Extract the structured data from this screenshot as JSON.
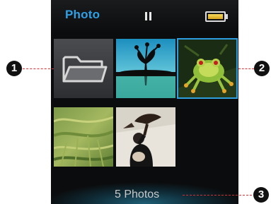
{
  "header": {
    "title": "Photo",
    "playback_icon": "pause-icon",
    "battery_icon": "battery-icon",
    "title_color": "#2f9fe6"
  },
  "grid": {
    "items": [
      {
        "kind": "folder",
        "icon": "folder-icon"
      },
      {
        "kind": "photo",
        "subject": "tree-silhouette-photo"
      },
      {
        "kind": "photo",
        "subject": "frog-photo",
        "selected": true
      },
      {
        "kind": "photo",
        "subject": "grass-photo"
      },
      {
        "kind": "photo",
        "subject": "bird-handler-photo"
      }
    ],
    "selection_color": "#2d9ee0"
  },
  "footer": {
    "count_text": "5 Photos"
  },
  "callouts": [
    {
      "number": "1"
    },
    {
      "number": "2"
    },
    {
      "number": "3"
    }
  ],
  "callout_color": "#d23030"
}
